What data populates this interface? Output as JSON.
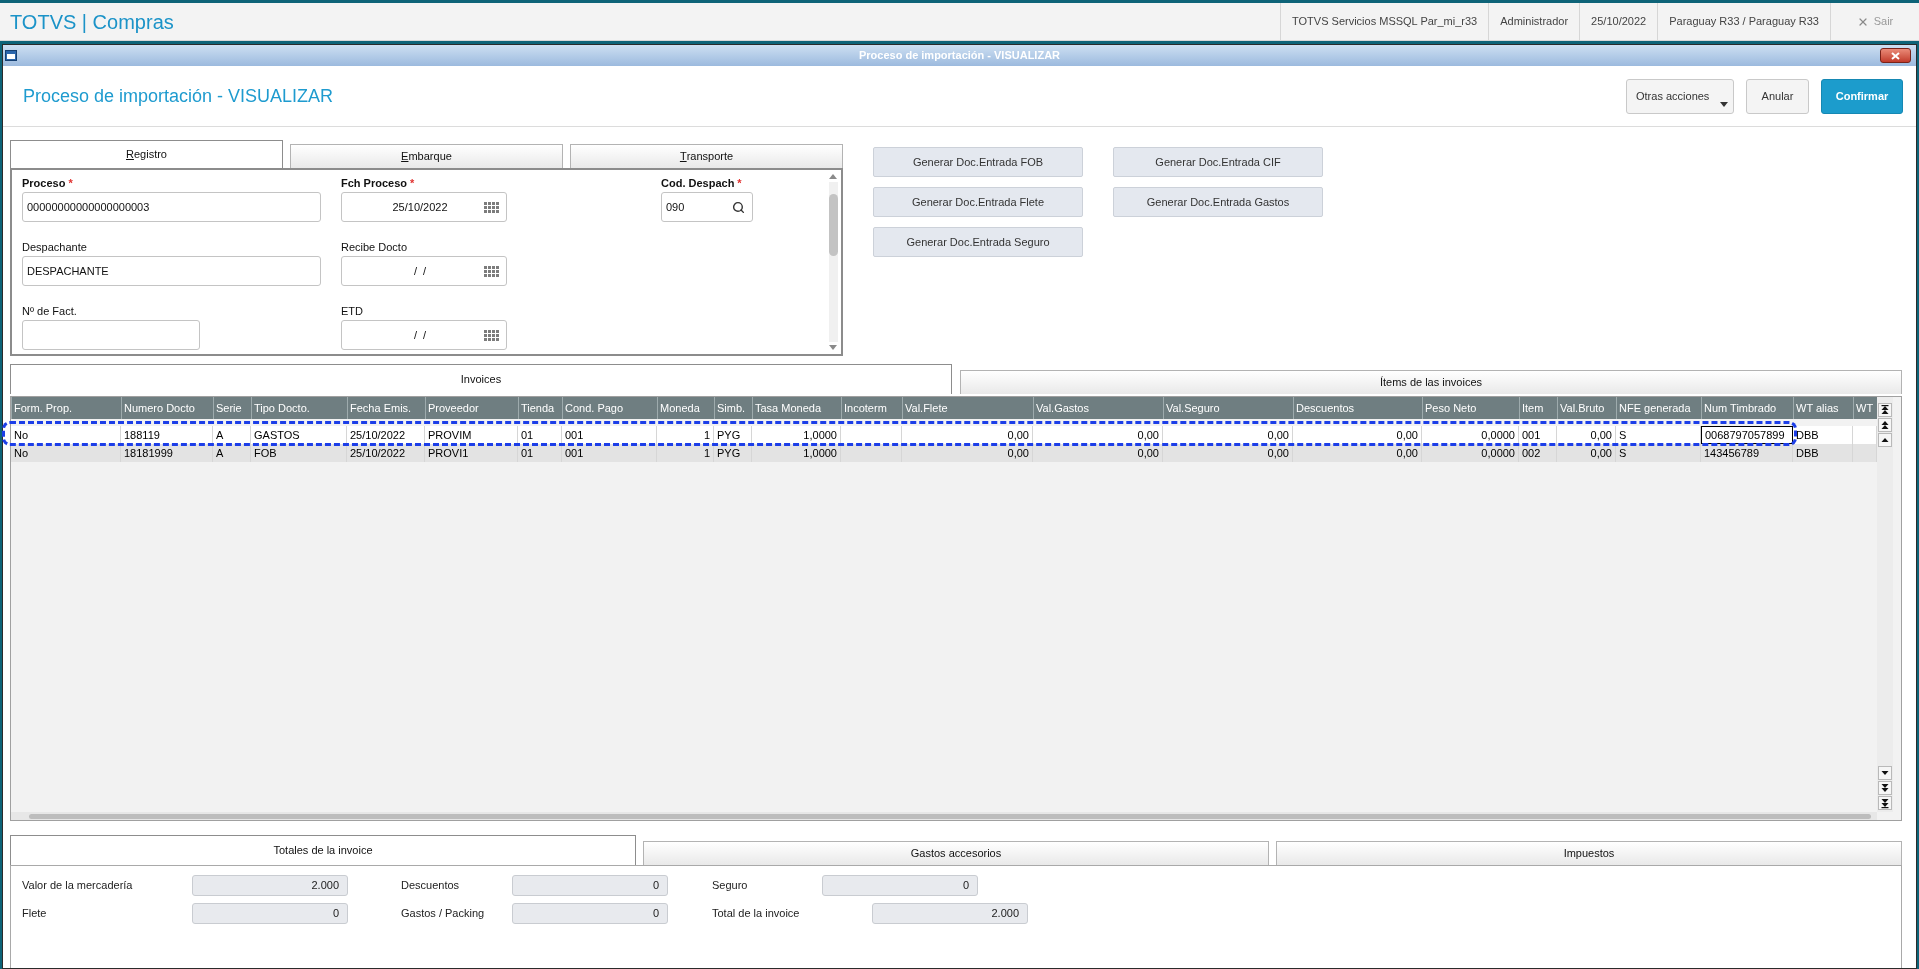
{
  "app_bar": {
    "title": "TOTVS | Compras",
    "info": [
      "TOTVS Servicios MSSQL Par_mi_r33",
      "Administrador",
      "25/10/2022",
      "Paraguay R33 / Paraguay R33"
    ],
    "exit": "Sair"
  },
  "window": {
    "title": "Proceso de importación - VISUALIZAR"
  },
  "header": {
    "title": "Proceso de importación - VISUALIZAR",
    "buttons": [
      {
        "label": "Otras acciones",
        "kind": "menu"
      },
      {
        "label": "Anular",
        "kind": "default"
      },
      {
        "label": "Confirmar",
        "kind": "primary"
      }
    ]
  },
  "form_tabs": [
    {
      "label": "Registro",
      "selected": true
    },
    {
      "label": "Embarque",
      "selected": false
    },
    {
      "label": "Transporte",
      "selected": false
    }
  ],
  "form_rows": [
    [
      {
        "label": "Proceso",
        "required_mark": "*",
        "kind": "text",
        "value": "00000000000000000003"
      },
      {
        "label": "Fch Proceso",
        "required_mark": "*",
        "kind": "date",
        "value": "25/10/2022"
      },
      {
        "label": "Cod. Despach",
        "required_mark": "*",
        "kind": "lookup",
        "value": "090"
      }
    ],
    [
      {
        "label": "Despachante",
        "kind": "text",
        "value": "DESPACHANTE"
      },
      {
        "label": "Recibe Docto",
        "kind": "date",
        "value": "/  /"
      }
    ],
    [
      {
        "label": "Nº de Fact.",
        "kind": "short_text"
      },
      {
        "label": "ETD",
        "kind": "date",
        "value": "/  /"
      }
    ]
  ],
  "form_actions": [
    "Generar Doc.Entrada FOB",
    "Generar Doc.Entrada CIF",
    "Generar Doc.Entrada Flete",
    "Generar Doc.Entrada Gastos",
    "Generar Doc.Entrada Seguro"
  ],
  "grid_tabs": [
    {
      "label": "Invoices",
      "selected": true
    },
    {
      "label": "Ítems de las invoices",
      "selected": false
    }
  ],
  "invoices_table": {
    "columns": [
      "Form. Prop.",
      "Numero Docto",
      "Serie",
      "Tipo Docto.",
      "Fecha Emis.",
      "Proveedor",
      "Tienda",
      "Cond. Pago",
      "Moneda",
      "Simb.",
      "Tasa Moneda",
      "Incoterm",
      "Val.Flete",
      "Val.Gastos",
      "Val.Seguro",
      "Descuentos",
      "Peso Neto",
      "Item",
      "Val.Bruto",
      "NFE generada",
      "Num Timbrado",
      "WT alias",
      "WT"
    ],
    "rows": [
      {
        "selected": true,
        "cells": [
          {
            "text": "No",
            "focused": false
          },
          {
            "text": "188119",
            "focused": false
          },
          {
            "text": "A",
            "focused": false
          },
          {
            "text": "GASTOS",
            "focused": false
          },
          {
            "text": "25/10/2022",
            "focused": false
          },
          {
            "text": "PROVIM",
            "focused": false
          },
          {
            "text": "01",
            "focused": false
          },
          {
            "text": "001",
            "focused": false
          },
          {
            "text": "1",
            "focused": false
          },
          {
            "text": "PYG",
            "focused": false
          },
          {
            "text": "1,0000",
            "focused": false
          },
          {
            "focused": false
          },
          {
            "text": "0,00",
            "focused": false
          },
          {
            "text": "0,00",
            "focused": false
          },
          {
            "text": "0,00",
            "focused": false
          },
          {
            "text": "0,00",
            "focused": false
          },
          {
            "text": "0,0000",
            "focused": false
          },
          {
            "text": "001",
            "focused": false
          },
          {
            "text": "0,00",
            "focused": false
          },
          {
            "text": "S",
            "focused": false
          },
          {
            "text": "0068797057899",
            "focused": true
          },
          {
            "text": "DBB",
            "focused": false
          },
          {
            "focused": false
          }
        ]
      },
      {
        "selected": false,
        "cells": [
          {
            "text": "No",
            "focused": false
          },
          {
            "text": "18181999",
            "focused": false
          },
          {
            "text": "A",
            "focused": false
          },
          {
            "text": "FOB",
            "focused": false
          },
          {
            "text": "25/10/2022",
            "focused": false
          },
          {
            "text": "PROVI1",
            "focused": false
          },
          {
            "text": "01",
            "focused": false
          },
          {
            "text": "001",
            "focused": false
          },
          {
            "text": "1",
            "focused": false
          },
          {
            "text": "PYG",
            "focused": false
          },
          {
            "text": "1,0000",
            "focused": false
          },
          {
            "focused": false
          },
          {
            "text": "0,00",
            "focused": false
          },
          {
            "text": "0,00",
            "focused": false
          },
          {
            "text": "0,00",
            "focused": false
          },
          {
            "text": "0,00",
            "focused": false
          },
          {
            "text": "0,0000",
            "focused": false
          },
          {
            "text": "002",
            "focused": false
          },
          {
            "text": "0,00",
            "focused": false
          },
          {
            "text": "S",
            "focused": false
          },
          {
            "text": "143456789",
            "focused": false
          },
          {
            "text": "DBB",
            "focused": false
          },
          {
            "focused": false
          }
        ]
      }
    ]
  },
  "totals_tabs": [
    {
      "label": "Totales de la invoice",
      "selected": true
    },
    {
      "label": "Gastos accesorios",
      "selected": false
    },
    {
      "label": "Impuestos",
      "selected": false
    }
  ],
  "totals": [
    {
      "label": "Valor de la mercadería",
      "value": "2.000"
    },
    {
      "label": "Descuentos",
      "value": "0"
    },
    {
      "label": "Seguro",
      "value": "0"
    },
    {
      "label": "Flete",
      "value": "0"
    },
    {
      "label": "Gastos / Packing",
      "value": "0"
    },
    {
      "label": "Total de la invoice",
      "value": "2.000"
    }
  ]
}
